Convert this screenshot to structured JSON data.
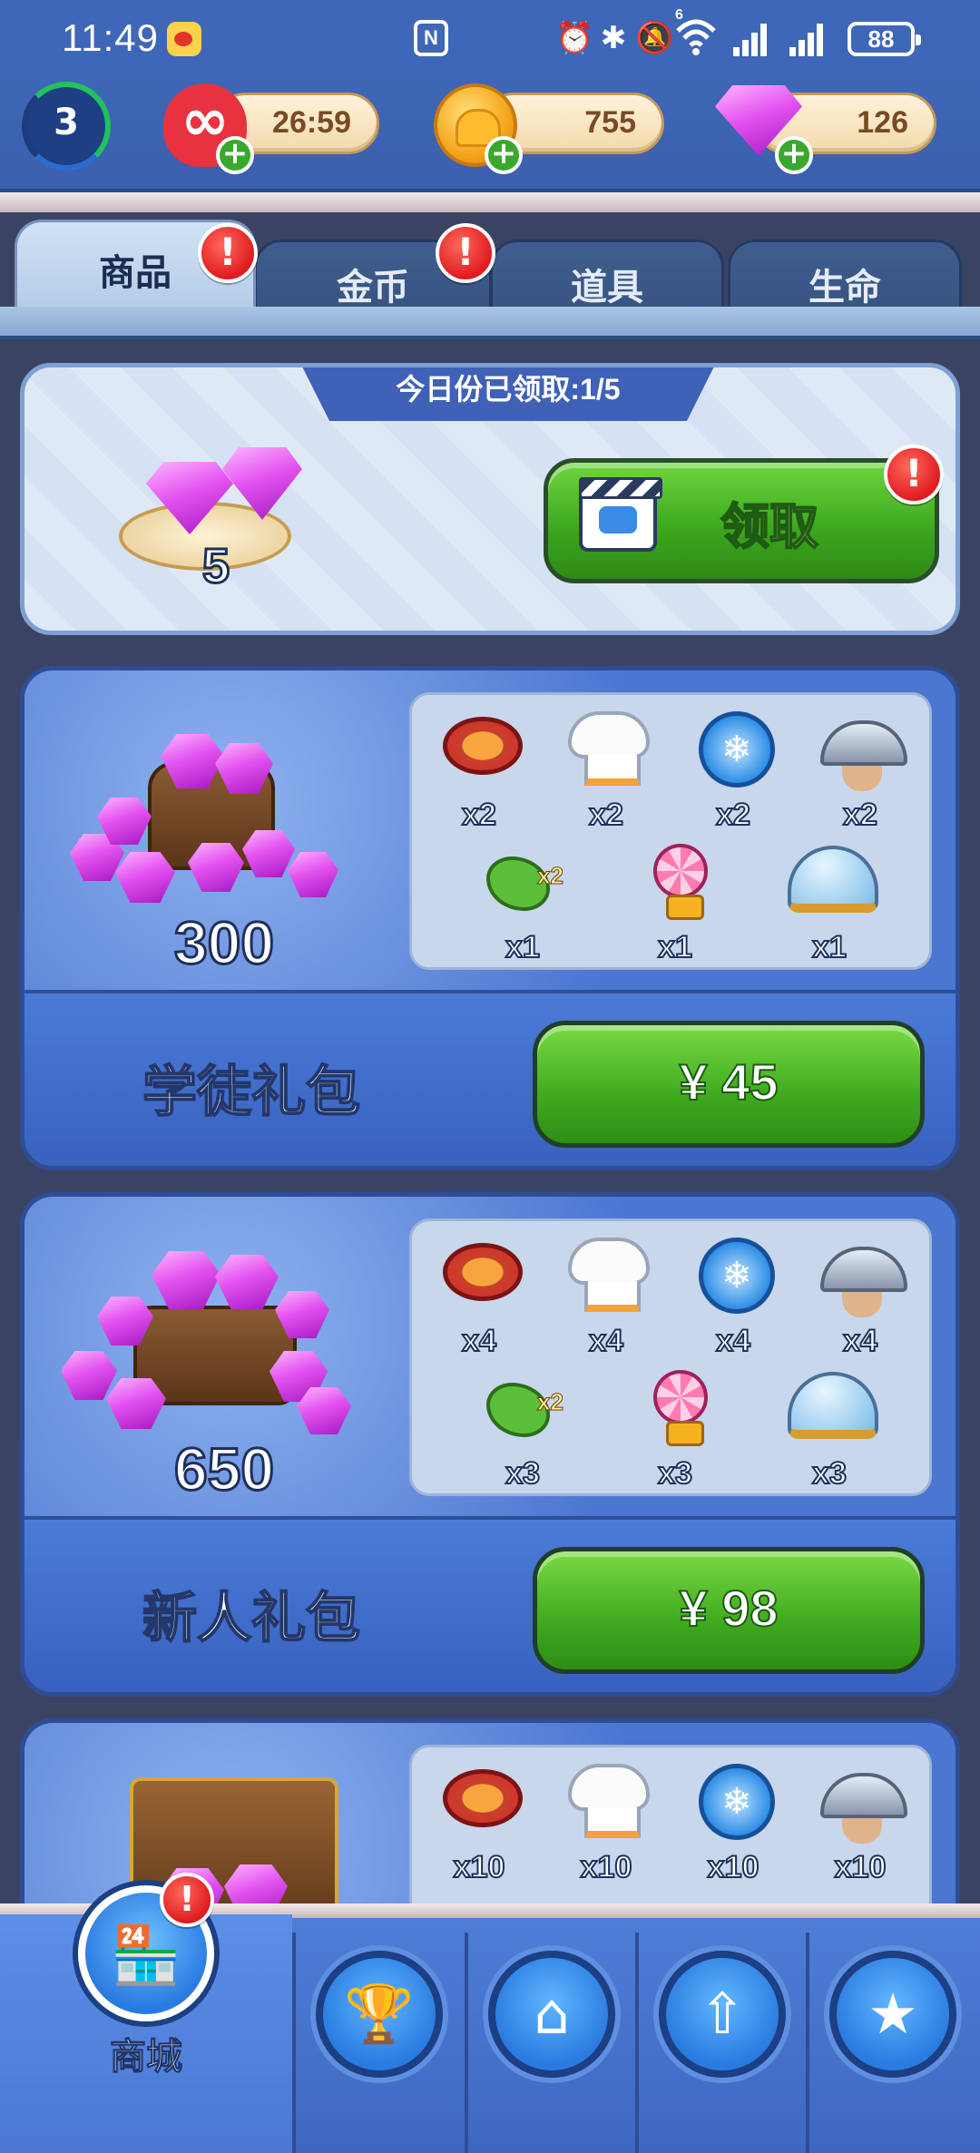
{
  "status_bar": {
    "time": "11:49",
    "battery": "88",
    "network_label": "6"
  },
  "resources": {
    "level": "3",
    "lives_timer": "26:59",
    "coins": "755",
    "gems": "126"
  },
  "tabs": [
    {
      "label": "商品",
      "active": true,
      "alert": "!"
    },
    {
      "label": "金币",
      "active": false,
      "alert": "!"
    },
    {
      "label": "道具",
      "active": false
    },
    {
      "label": "生命",
      "active": false
    }
  ],
  "daily_offer": {
    "banner": "今日份已领取:1/5",
    "gem_quantity": "5",
    "claim_label": "领取",
    "alert": "!"
  },
  "bundles": [
    {
      "name": "学徒礼包",
      "gems": "300",
      "price": "¥ 45",
      "items": [
        {
          "icon": "pan-icon",
          "qty": "x2"
        },
        {
          "icon": "chef-hat-icon",
          "qty": "x2"
        },
        {
          "icon": "freeze-clock-icon",
          "qty": "x2"
        },
        {
          "icon": "cloche-icon",
          "qty": "x2"
        },
        {
          "icon": "double-coin-icon",
          "qty": "x1"
        },
        {
          "icon": "lollipop-icon",
          "qty": "x1"
        },
        {
          "icon": "glass-dome-icon",
          "qty": "x1"
        }
      ]
    },
    {
      "name": "新人礼包",
      "gems": "650",
      "price": "¥ 98",
      "items": [
        {
          "icon": "pan-icon",
          "qty": "x4"
        },
        {
          "icon": "chef-hat-icon",
          "qty": "x4"
        },
        {
          "icon": "freeze-clock-icon",
          "qty": "x4"
        },
        {
          "icon": "cloche-icon",
          "qty": "x4"
        },
        {
          "icon": "double-coin-icon",
          "qty": "x3"
        },
        {
          "icon": "lollipop-icon",
          "qty": "x3"
        },
        {
          "icon": "glass-dome-icon",
          "qty": "x3"
        }
      ]
    },
    {
      "name": "",
      "gems": "",
      "price": "",
      "items": [
        {
          "icon": "pan-icon",
          "qty": "x10"
        },
        {
          "icon": "chef-hat-icon",
          "qty": "x10"
        },
        {
          "icon": "freeze-clock-icon",
          "qty": "x10"
        },
        {
          "icon": "cloche-icon",
          "qty": "x10"
        }
      ]
    }
  ],
  "bottom_nav": {
    "shop_label": "商城",
    "shop_alert": "!",
    "items": [
      "shop-icon",
      "leaderboard-icon",
      "home-icon",
      "chef-upgrade-icon",
      "cards-icon"
    ]
  },
  "colors": {
    "header_blue": "#3f67b7",
    "green_button": "#3faa1f",
    "alert_red": "#e01b21",
    "gem_pink": "#e252f0"
  }
}
